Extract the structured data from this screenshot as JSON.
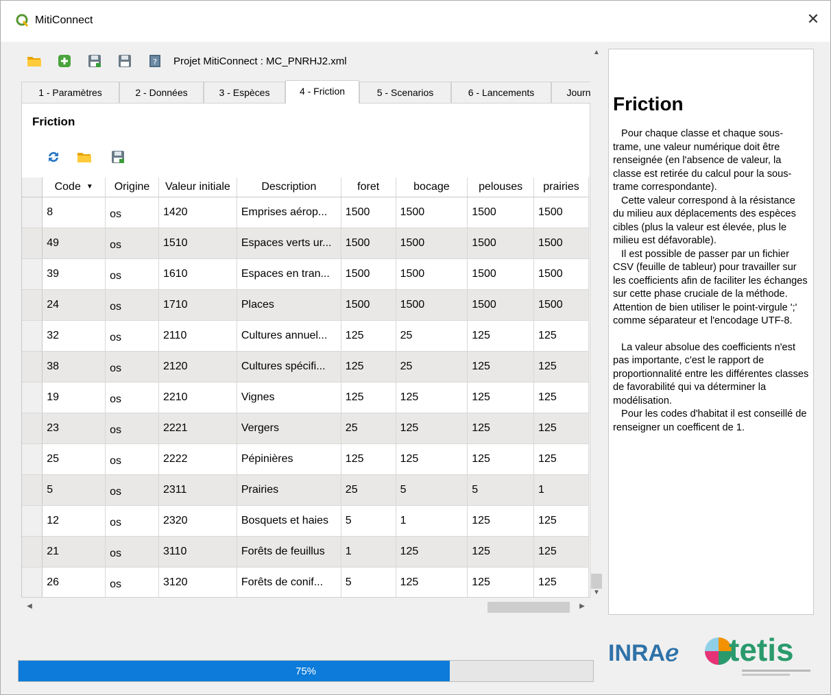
{
  "window": {
    "title": "MitiConnect",
    "close_glyph": "✕"
  },
  "toolbar": {
    "buttons": [
      "open-folder-icon",
      "add-icon",
      "save-icon",
      "save-as-icon",
      "help-book-icon"
    ],
    "project_label": "Projet MitiConnect : MC_PNRHJ2.xml"
  },
  "tabs": [
    {
      "label": "1 - Paramètres",
      "active": false
    },
    {
      "label": "2 - Données",
      "active": false
    },
    {
      "label": "3 - Espèces",
      "active": false
    },
    {
      "label": "4 - Friction",
      "active": true
    },
    {
      "label": "5 - Scenarios",
      "active": false
    },
    {
      "label": "6 - Lancements",
      "active": false
    },
    {
      "label": "Journ",
      "active": false
    }
  ],
  "friction": {
    "title": "Friction",
    "tools": [
      "refresh-icon",
      "open-folder-icon",
      "save-icon"
    ],
    "columns": [
      "Code",
      "Origine",
      "Valeur initiale",
      "Description",
      "foret",
      "bocage",
      "pelouses",
      "prairies"
    ],
    "rows": [
      [
        "8",
        "os",
        "1420",
        "Emprises aérop...",
        "1500",
        "1500",
        "1500",
        "1500"
      ],
      [
        "49",
        "os",
        "1510",
        "Espaces verts ur...",
        "1500",
        "1500",
        "1500",
        "1500"
      ],
      [
        "39",
        "os",
        "1610",
        "Espaces en tran...",
        "1500",
        "1500",
        "1500",
        "1500"
      ],
      [
        "24",
        "os",
        "1710",
        "Places",
        "1500",
        "1500",
        "1500",
        "1500"
      ],
      [
        "32",
        "os",
        "2110",
        "Cultures annuel...",
        "125",
        "25",
        "125",
        "125"
      ],
      [
        "38",
        "os",
        "2120",
        "Cultures spécifi...",
        "125",
        "25",
        "125",
        "125"
      ],
      [
        "19",
        "os",
        "2210",
        "Vignes",
        "125",
        "125",
        "125",
        "125"
      ],
      [
        "23",
        "os",
        "2221",
        "Vergers",
        "25",
        "125",
        "125",
        "125"
      ],
      [
        "25",
        "os",
        "2222",
        "Pépinières",
        "125",
        "125",
        "125",
        "125"
      ],
      [
        "5",
        "os",
        "2311",
        "Prairies",
        "25",
        "5",
        "5",
        "1"
      ],
      [
        "12",
        "os",
        "2320",
        "Bosquets et haies",
        "5",
        "1",
        "125",
        "125"
      ],
      [
        "21",
        "os",
        "3110",
        "Forêts de feuillus",
        "1",
        "125",
        "125",
        "125"
      ],
      [
        "26",
        "os",
        "3120",
        "Forêts de conif...",
        "5",
        "125",
        "125",
        "125"
      ]
    ]
  },
  "help": {
    "title": "Friction",
    "p1": "Pour chaque classe et chaque sous-trame, une valeur numérique doit être renseignée (en l'absence de valeur, la classe est retirée du calcul pour la sous-trame correspondante).",
    "p2": "Cette valeur correspond à la résistance du milieu aux déplacements des espèces cibles (plus la valeur est élevée, plus le milieu est défavorable).",
    "p3": "Il est possible de passer par un fichier CSV (feuille de tableur) pour travailler sur les coefficients afin de faciliter les échanges sur cette phase cruciale de la méthode. Attention de bien utiliser le point-virgule ';' comme séparateur et l'encodage UTF-8.",
    "p4": "La valeur absolue des coefficients n'est pas importante, c'est le rapport de proportionnalité entre les différentes classes de favorabilité qui va déterminer la modélisation.",
    "p5": "Pour les codes d'habitat il est conseillé de renseigner un coefficent de 1."
  },
  "logos": {
    "inrae": "INRAℯ",
    "tetis": "tetis"
  },
  "progress": {
    "value": 0.75,
    "label": "75%"
  },
  "colors": {
    "accent": "#0c7bd9",
    "alt_row": "#e9e8e6",
    "qgis_green": "#589632"
  }
}
